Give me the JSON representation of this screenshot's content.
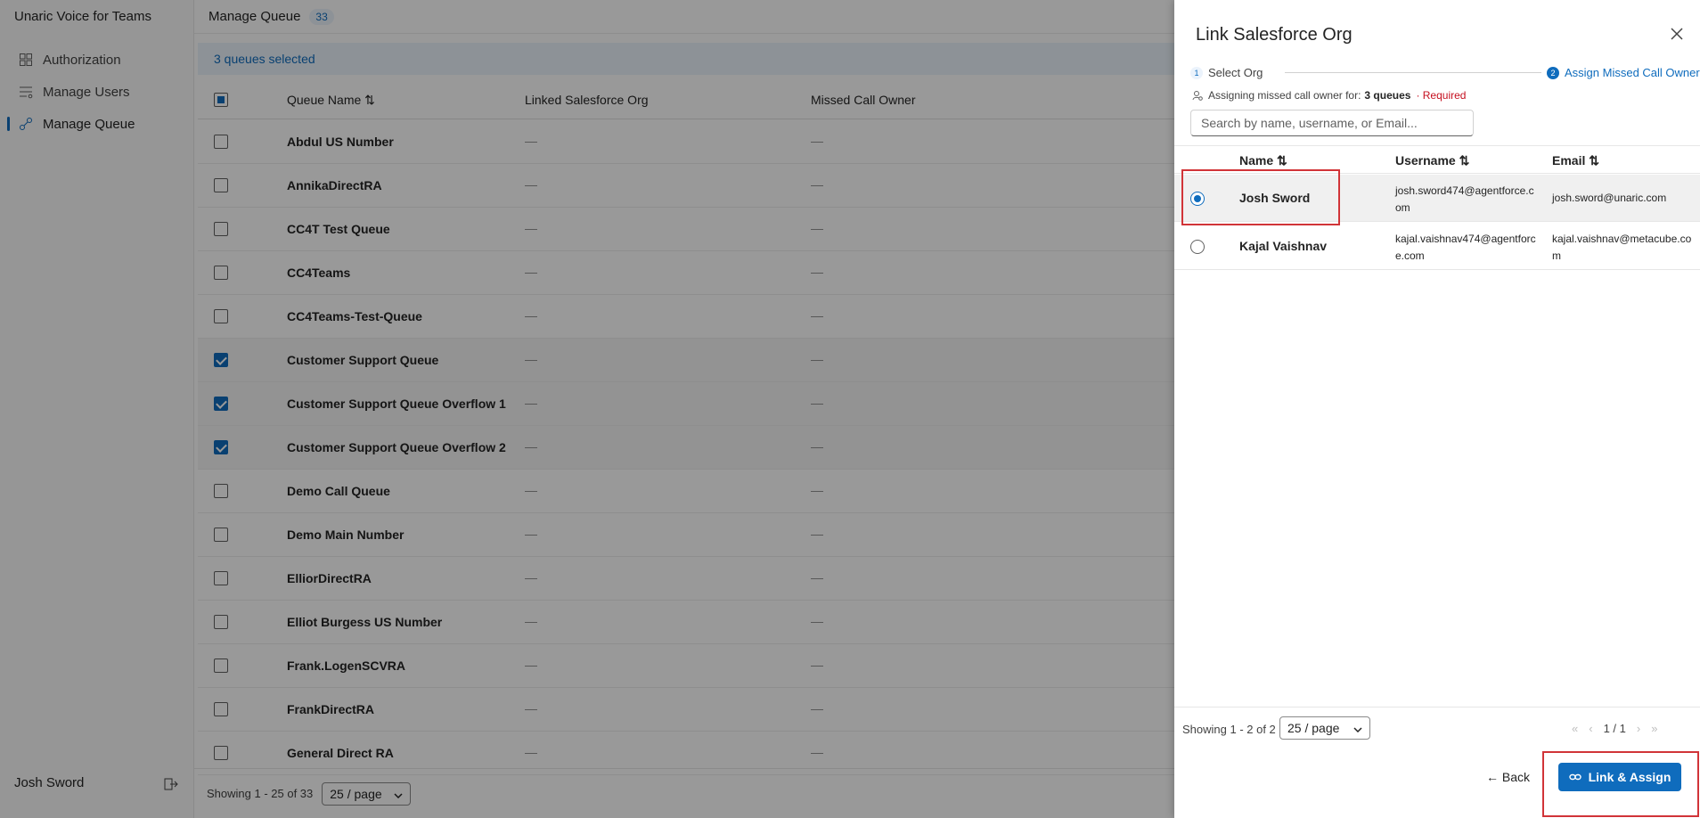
{
  "app": {
    "title": "Unaric Voice for Teams"
  },
  "sidebar": {
    "items": [
      {
        "label": "Authorization",
        "icon": "grid-icon"
      },
      {
        "label": "Manage Users",
        "icon": "list-icon"
      },
      {
        "label": "Manage Queue",
        "icon": "queue-icon",
        "active": true
      }
    ],
    "user_name": "Josh Sword"
  },
  "main": {
    "title": "Manage Queue",
    "count": "33",
    "selection_text": "3 queues selected",
    "columns": {
      "queue_name": "Queue Name ⇅",
      "linked_org": "Linked Salesforce Org",
      "missed_owner": "Missed Call Owner"
    },
    "empty_value": "—",
    "rows": [
      {
        "name": "Abdul US Number",
        "checked": false
      },
      {
        "name": "AnnikaDirectRA",
        "checked": false
      },
      {
        "name": "CC4T Test Queue",
        "checked": false
      },
      {
        "name": "CC4Teams",
        "checked": false
      },
      {
        "name": "CC4Teams-Test-Queue",
        "checked": false
      },
      {
        "name": "Customer Support Queue",
        "checked": true
      },
      {
        "name": "Customer Support Queue Overflow 1",
        "checked": true
      },
      {
        "name": "Customer Support Queue Overflow 2",
        "checked": true
      },
      {
        "name": "Demo Call Queue",
        "checked": false
      },
      {
        "name": "Demo Main Number",
        "checked": false
      },
      {
        "name": "ElliorDirectRA",
        "checked": false
      },
      {
        "name": "Elliot Burgess US Number",
        "checked": false
      },
      {
        "name": "Frank.LogenSCVRA",
        "checked": false
      },
      {
        "name": "FrankDirectRA",
        "checked": false
      },
      {
        "name": "General Direct RA",
        "checked": false
      }
    ],
    "footer": {
      "showing": "Showing 1 - 25 of 33",
      "page_size": "25 / page"
    }
  },
  "drawer": {
    "title": "Link Salesforce Org",
    "steps": [
      {
        "num": "1",
        "label": "Select Org"
      },
      {
        "num": "2",
        "label": "Assign Missed Call Owner"
      }
    ],
    "assigning_prefix": "Assigning missed call owner for:",
    "assigning_count": "3 queues",
    "required": "· Required",
    "search_placeholder": "Search by name, username, or Email...",
    "columns": {
      "name": "Name ⇅",
      "username": "Username ⇅",
      "email": "Email ⇅"
    },
    "users": [
      {
        "name": "Josh Sword",
        "username": "josh.sword474@agentforce.com",
        "email": "josh.sword@unaric.com",
        "selected": true
      },
      {
        "name": "Kajal Vaishnav",
        "username": "kajal.vaishnav474@agentforce.com",
        "email": "kajal.vaishnav@metacube.com",
        "selected": false
      }
    ],
    "showing": "Showing 1 - 2 of 2",
    "page_size": "25 / page",
    "page": "1 / 1",
    "back_label": "← Back",
    "primary_label": "Link & Assign"
  }
}
